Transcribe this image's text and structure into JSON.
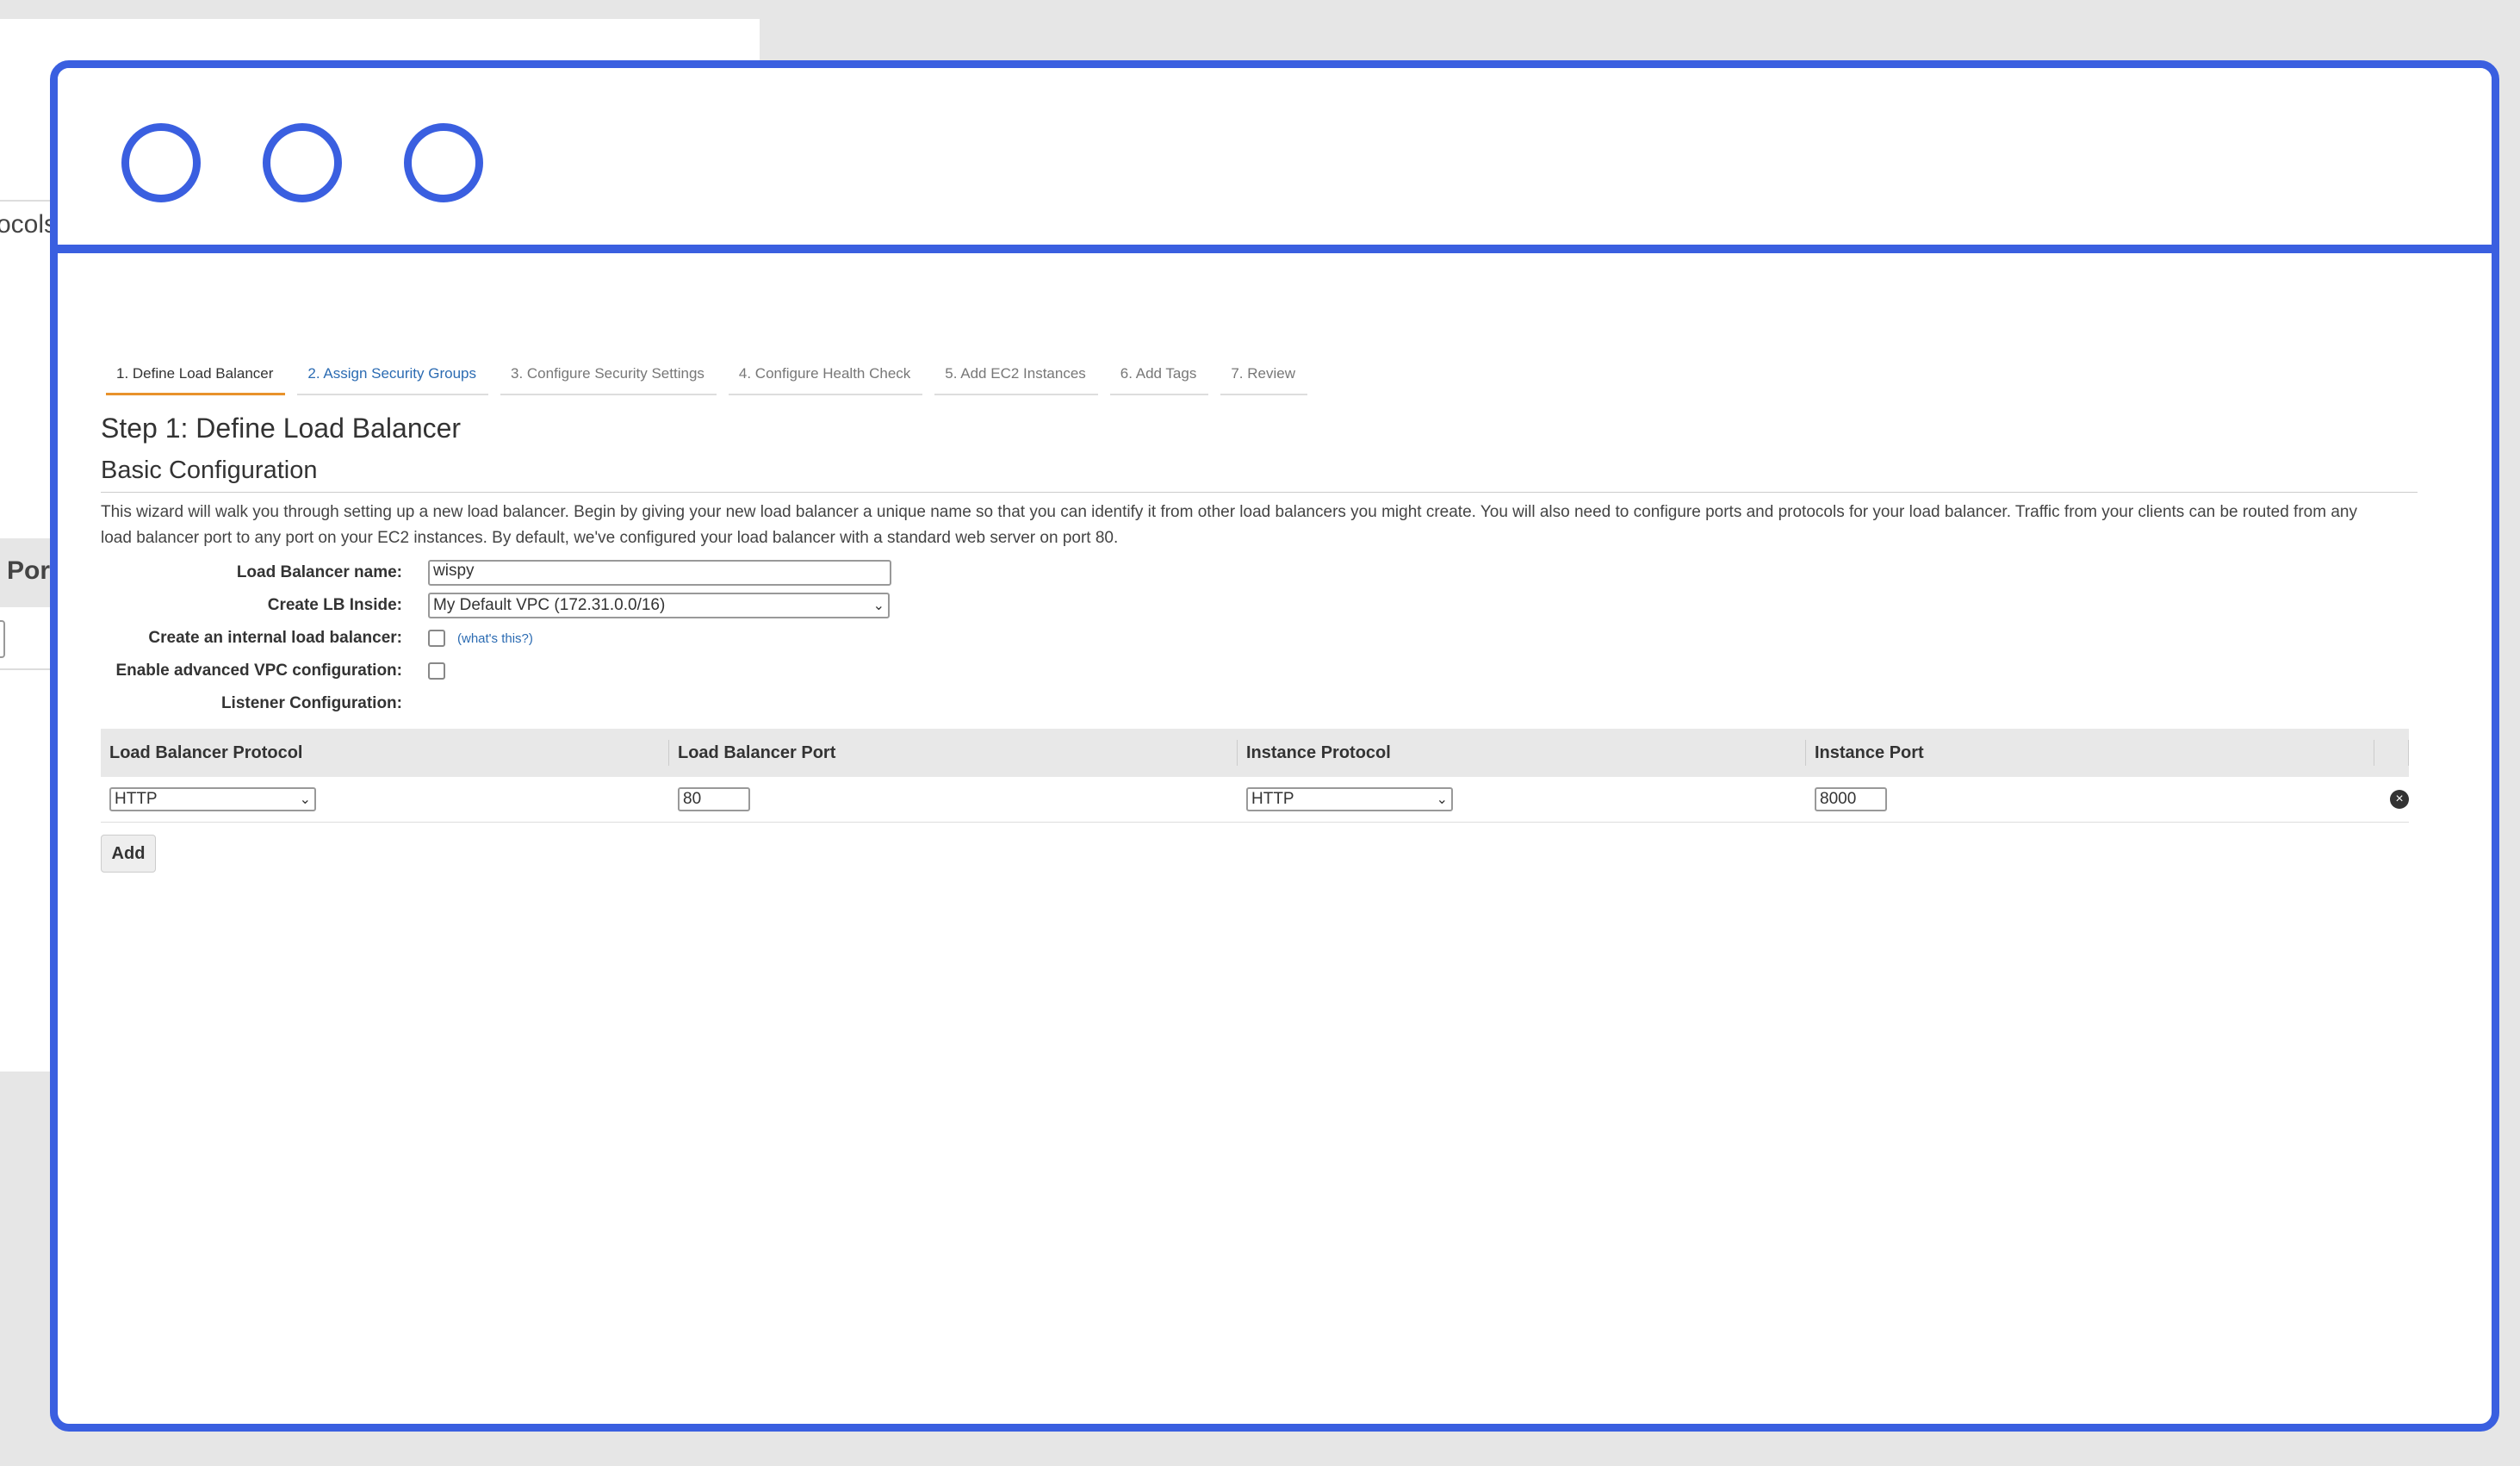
{
  "background": {
    "partial_text_1": "ocols",
    "partial_text_2": "Port"
  },
  "colors": {
    "frame": "#3a5fe0",
    "active_tab": "#e8922b",
    "link": "#2b6bb2"
  },
  "tabs": [
    {
      "label": "1. Define Load Balancer"
    },
    {
      "label": "2. Assign Security Groups"
    },
    {
      "label": "3. Configure Security Settings"
    },
    {
      "label": "4. Configure Health Check"
    },
    {
      "label": "5. Add EC2 Instances"
    },
    {
      "label": "6. Add Tags"
    },
    {
      "label": "7. Review"
    }
  ],
  "page": {
    "title": "Step 1: Define Load Balancer",
    "section": "Basic Configuration",
    "description": "This wizard will walk you through setting up a new load balancer. Begin by giving your new load balancer a unique name so that you can identify it from other load balancers you might create. You will also need to configure ports and protocols for your load balancer. Traffic from your clients can be routed from any load balancer port to any port on your EC2 instances. By default, we've configured your load balancer with a standard web server on port 80."
  },
  "form": {
    "name_label": "Load Balancer name:",
    "name_value": "wispy",
    "inside_label": "Create LB Inside:",
    "inside_value": "My Default VPC (172.31.0.0/16)",
    "internal_label": "Create an internal load balancer:",
    "whats_this": "(what's this?)",
    "advanced_label": "Enable advanced VPC configuration:",
    "listener_label": "Listener Configuration:"
  },
  "listeners": {
    "headers": [
      "Load Balancer Protocol",
      "Load Balancer Port",
      "Instance Protocol",
      "Instance Port"
    ],
    "row": {
      "lb_protocol": "HTTP",
      "lb_port": "80",
      "instance_protocol": "HTTP",
      "instance_port": "8000"
    },
    "add_label": "Add"
  }
}
